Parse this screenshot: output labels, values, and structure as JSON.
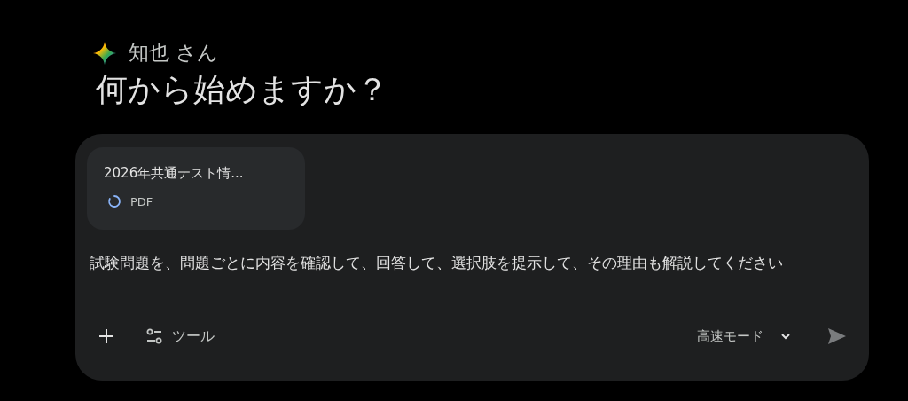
{
  "greeting": {
    "name": "知也 さん",
    "title": "何から始めますか？"
  },
  "composer": {
    "attachment": {
      "name": "2026年共通テスト情...",
      "type": "PDF"
    },
    "value": "試験問題を、問題ごとに内容を確認して、回答して、選択肢を提示して、その理由も解説してください",
    "tools_label": "ツール",
    "mode": "高速モード"
  }
}
